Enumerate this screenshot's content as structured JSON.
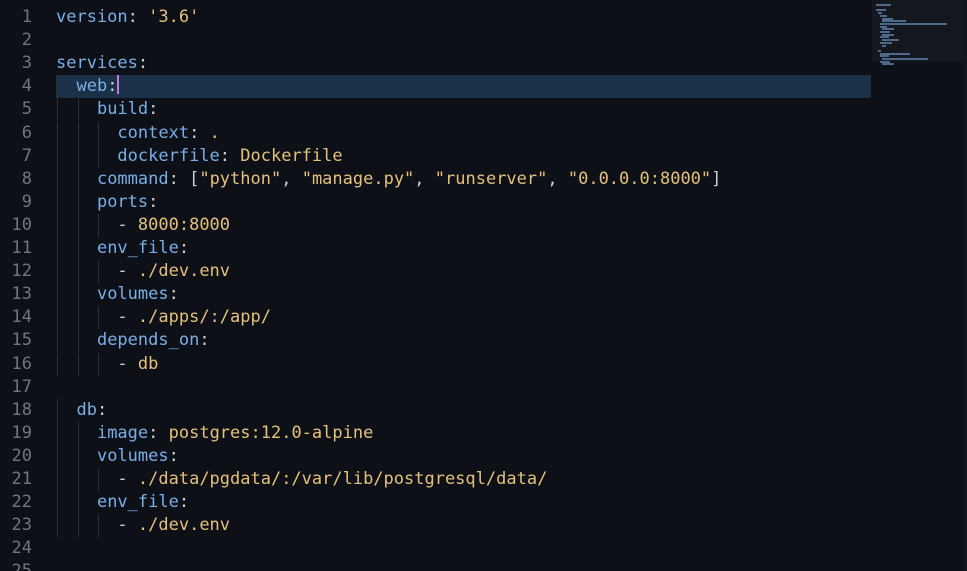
{
  "editor": {
    "language": "yaml",
    "current_line": 4,
    "lines": [
      {
        "n": "1",
        "indent": 0,
        "tokens": [
          {
            "t": "version",
            "c": "key"
          },
          {
            "t": ": ",
            "c": "punc"
          },
          {
            "t": "'3.6'",
            "c": "str"
          }
        ]
      },
      {
        "n": "2",
        "indent": 0,
        "tokens": []
      },
      {
        "n": "3",
        "indent": 0,
        "tokens": [
          {
            "t": "services",
            "c": "key"
          },
          {
            "t": ":",
            "c": "punc"
          }
        ]
      },
      {
        "n": "4",
        "indent": 1,
        "tokens": [
          {
            "t": "web",
            "c": "key"
          },
          {
            "t": ":",
            "c": "punc"
          }
        ],
        "cursor": true
      },
      {
        "n": "5",
        "indent": 2,
        "tokens": [
          {
            "t": "build",
            "c": "key"
          },
          {
            "t": ":",
            "c": "punc"
          }
        ]
      },
      {
        "n": "6",
        "indent": 3,
        "tokens": [
          {
            "t": "context",
            "c": "key"
          },
          {
            "t": ": ",
            "c": "punc"
          },
          {
            "t": ".",
            "c": "str"
          }
        ]
      },
      {
        "n": "7",
        "indent": 3,
        "tokens": [
          {
            "t": "dockerfile",
            "c": "key"
          },
          {
            "t": ": ",
            "c": "punc"
          },
          {
            "t": "Dockerfile",
            "c": "str"
          }
        ]
      },
      {
        "n": "8",
        "indent": 2,
        "tokens": [
          {
            "t": "command",
            "c": "key"
          },
          {
            "t": ": [",
            "c": "punc"
          },
          {
            "t": "\"python\"",
            "c": "str"
          },
          {
            "t": ", ",
            "c": "punc"
          },
          {
            "t": "\"manage.py\"",
            "c": "str"
          },
          {
            "t": ", ",
            "c": "punc"
          },
          {
            "t": "\"runserver\"",
            "c": "str"
          },
          {
            "t": ", ",
            "c": "punc"
          },
          {
            "t": "\"0.0.0.0:8000\"",
            "c": "str"
          },
          {
            "t": "]",
            "c": "punc"
          }
        ]
      },
      {
        "n": "9",
        "indent": 2,
        "tokens": [
          {
            "t": "ports",
            "c": "key"
          },
          {
            "t": ":",
            "c": "punc"
          }
        ]
      },
      {
        "n": "10",
        "indent": 3,
        "tokens": [
          {
            "t": "- ",
            "c": "punc"
          },
          {
            "t": "8000:8000",
            "c": "str"
          }
        ]
      },
      {
        "n": "11",
        "indent": 2,
        "tokens": [
          {
            "t": "env_file",
            "c": "key"
          },
          {
            "t": ":",
            "c": "punc"
          }
        ]
      },
      {
        "n": "12",
        "indent": 3,
        "tokens": [
          {
            "t": "- ",
            "c": "punc"
          },
          {
            "t": "./dev.env",
            "c": "str"
          }
        ]
      },
      {
        "n": "13",
        "indent": 2,
        "tokens": [
          {
            "t": "volumes",
            "c": "key"
          },
          {
            "t": ":",
            "c": "punc"
          }
        ]
      },
      {
        "n": "14",
        "indent": 3,
        "tokens": [
          {
            "t": "- ",
            "c": "punc"
          },
          {
            "t": "./apps/:/app/",
            "c": "str"
          }
        ]
      },
      {
        "n": "15",
        "indent": 2,
        "tokens": [
          {
            "t": "depends_on",
            "c": "key"
          },
          {
            "t": ":",
            "c": "punc"
          }
        ]
      },
      {
        "n": "16",
        "indent": 3,
        "tokens": [
          {
            "t": "- ",
            "c": "punc"
          },
          {
            "t": "db",
            "c": "str"
          }
        ]
      },
      {
        "n": "17",
        "indent": 0,
        "tokens": []
      },
      {
        "n": "18",
        "indent": 1,
        "tokens": [
          {
            "t": "db",
            "c": "key"
          },
          {
            "t": ":",
            "c": "punc"
          }
        ]
      },
      {
        "n": "19",
        "indent": 2,
        "tokens": [
          {
            "t": "image",
            "c": "key"
          },
          {
            "t": ": ",
            "c": "punc"
          },
          {
            "t": "postgres:12.0-alpine",
            "c": "str"
          }
        ]
      },
      {
        "n": "20",
        "indent": 2,
        "tokens": [
          {
            "t": "volumes",
            "c": "key"
          },
          {
            "t": ":",
            "c": "punc"
          }
        ]
      },
      {
        "n": "21",
        "indent": 3,
        "tokens": [
          {
            "t": "- ",
            "c": "punc"
          },
          {
            "t": "./data/pgdata/:/var/lib/postgresql/data/",
            "c": "str"
          }
        ]
      },
      {
        "n": "22",
        "indent": 2,
        "tokens": [
          {
            "t": "env_file",
            "c": "key"
          },
          {
            "t": ":",
            "c": "punc"
          }
        ]
      },
      {
        "n": "23",
        "indent": 3,
        "tokens": [
          {
            "t": "- ",
            "c": "punc"
          },
          {
            "t": "./dev.env",
            "c": "str"
          }
        ]
      },
      {
        "n": "24",
        "indent": 0,
        "tokens": []
      },
      {
        "n": "25",
        "indent": 0,
        "tokens": []
      }
    ]
  },
  "colors": {
    "background": "#0d1117",
    "key": "#79aee8",
    "string": "#e5c07b",
    "punctuation": "#c9d1d9",
    "line_number": "#6e7681",
    "current_line": "#1b3148",
    "cursor": "#c678dd"
  }
}
